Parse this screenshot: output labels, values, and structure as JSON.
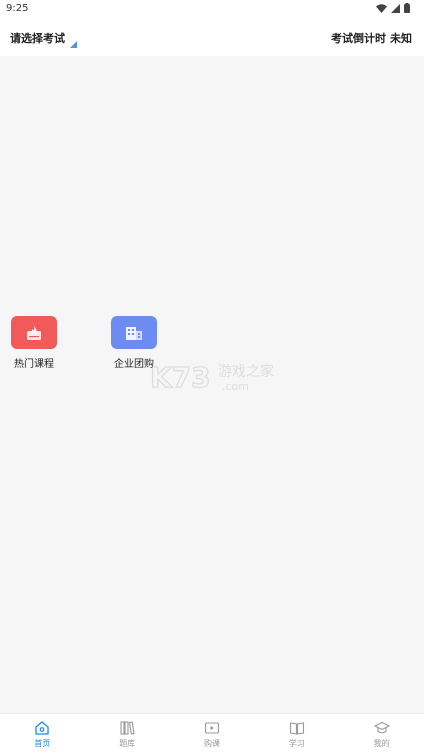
{
  "status_bar": {
    "time": "9:25"
  },
  "header": {
    "exam_select_label": "请选择考试",
    "countdown_label": "考试倒计时",
    "countdown_value": "未知"
  },
  "shortcuts": [
    {
      "label": "热门课程",
      "icon": "fire-book-icon",
      "color": "#f25a5a"
    },
    {
      "label": "企业团购",
      "icon": "building-icon",
      "color": "#6c8cf2"
    }
  ],
  "watermark": {
    "brand": "K73",
    "text": "游戏之家",
    "domain": ".com"
  },
  "tabs": [
    {
      "label": "首页",
      "icon": "home-icon",
      "active": true
    },
    {
      "label": "题库",
      "icon": "books-icon",
      "active": false
    },
    {
      "label": "购课",
      "icon": "video-icon",
      "active": false
    },
    {
      "label": "学习",
      "icon": "open-book-icon",
      "active": false
    },
    {
      "label": "我的",
      "icon": "graduation-cap-icon",
      "active": false
    }
  ],
  "colors": {
    "accent": "#1e88e5",
    "tab_inactive": "#999999"
  }
}
